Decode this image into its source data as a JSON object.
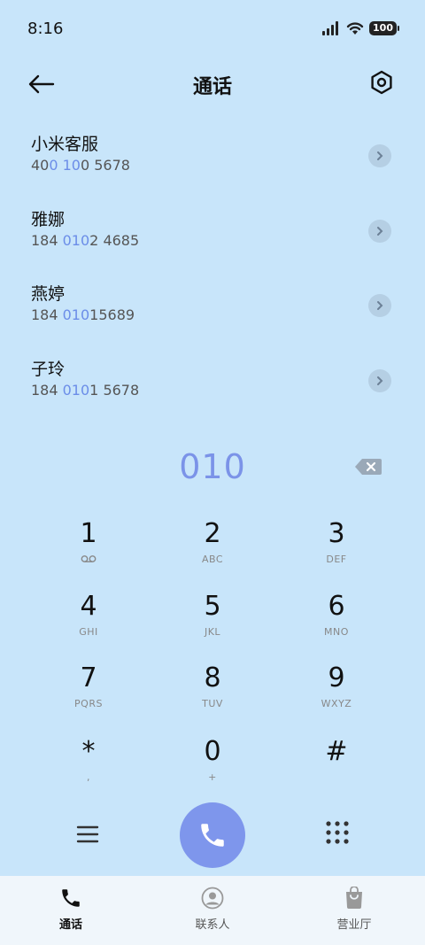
{
  "status_bar": {
    "time": "8:16",
    "battery": "100"
  },
  "header": {
    "title": "通话",
    "back_icon": "arrow-left-icon",
    "settings_icon": "hexagon-settings-icon"
  },
  "contacts": [
    {
      "name": "小米客服",
      "number_pre": "40",
      "number_hl": "0 10",
      "number_post": "0 5678"
    },
    {
      "name": "雅娜",
      "number_pre": "184 ",
      "number_hl": "010",
      "number_post": "2 4685"
    },
    {
      "name": "燕婷",
      "number_pre": "184 ",
      "number_hl": "010",
      "number_post": "15689"
    },
    {
      "name": "子玲",
      "number_pre": "184 ",
      "number_hl": "010",
      "number_post": "1 5678"
    }
  ],
  "dialer": {
    "input": "010"
  },
  "keypad": {
    "keys": [
      {
        "digit": "1",
        "letters": ""
      },
      {
        "digit": "2",
        "letters": "ABC"
      },
      {
        "digit": "3",
        "letters": "DEF"
      },
      {
        "digit": "4",
        "letters": "GHI"
      },
      {
        "digit": "5",
        "letters": "JKL"
      },
      {
        "digit": "6",
        "letters": "MNO"
      },
      {
        "digit": "7",
        "letters": "PQRS"
      },
      {
        "digit": "8",
        "letters": "TUV"
      },
      {
        "digit": "9",
        "letters": "WXYZ"
      },
      {
        "digit": "*",
        "letters": ","
      },
      {
        "digit": "0",
        "letters": "+"
      },
      {
        "digit": "#",
        "letters": ""
      }
    ]
  },
  "bottom_nav": {
    "tabs": [
      {
        "label": "通话",
        "icon": "phone-icon",
        "active": true
      },
      {
        "label": "联系人",
        "icon": "person-icon",
        "active": false
      },
      {
        "label": "营业厅",
        "icon": "shopping-bag-icon",
        "active": false
      }
    ]
  },
  "colors": {
    "background": "#c8e5fa",
    "accent": "#7e96ec",
    "highlight_text": "#6b8de8"
  }
}
